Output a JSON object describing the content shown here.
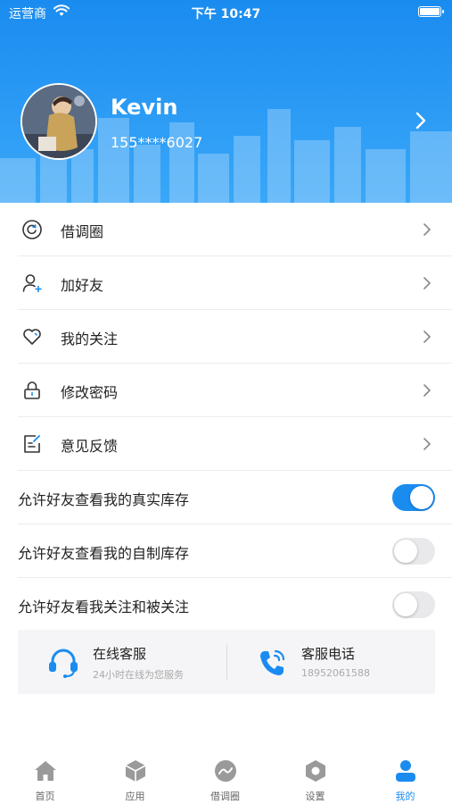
{
  "status_bar": {
    "carrier": "运营商",
    "time": "下午 10:47"
  },
  "profile": {
    "name": "Kevin",
    "phone": "155****6027"
  },
  "menu": [
    {
      "label": "借调圈",
      "icon": "circle-refresh-icon"
    },
    {
      "label": "加好友",
      "icon": "add-friend-icon"
    },
    {
      "label": "我的关注",
      "icon": "heart-icon"
    },
    {
      "label": "修改密码",
      "icon": "lock-icon"
    },
    {
      "label": "意见反馈",
      "icon": "feedback-edit-icon"
    }
  ],
  "toggles": [
    {
      "label": "允许好友查看我的真实库存",
      "on": true
    },
    {
      "label": "允许好友查看我的自制库存",
      "on": false
    },
    {
      "label": "允许好友看我关注和被关注",
      "on": false
    }
  ],
  "service": {
    "online": {
      "title": "在线客服",
      "subtitle": "24小时在线为您服务",
      "icon": "headset-icon"
    },
    "phone": {
      "title": "客服电话",
      "subtitle": "18952061588",
      "icon": "phone-icon"
    }
  },
  "tabs": [
    {
      "label": "首页",
      "icon": "home-icon",
      "active": false
    },
    {
      "label": "应用",
      "icon": "cube-icon",
      "active": false
    },
    {
      "label": "借调圈",
      "icon": "circle-icon",
      "active": false
    },
    {
      "label": "设置",
      "icon": "hexagon-icon",
      "active": false
    },
    {
      "label": "我的",
      "icon": "user-icon",
      "active": true
    }
  ],
  "colors": {
    "accent": "#1a8cf0",
    "header_top": "#1a8cf0",
    "header_bottom": "#3aa7f7",
    "toggle_off": "#e9e9eb"
  }
}
